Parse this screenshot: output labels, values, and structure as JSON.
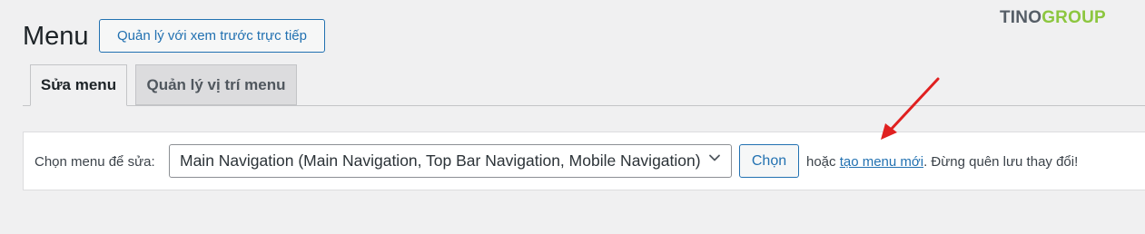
{
  "header": {
    "title": "Menu",
    "preview_button": "Quản lý với xem trước trực tiếp"
  },
  "logo": {
    "part1": "TINO",
    "part2": "GROUP"
  },
  "tabs": [
    {
      "label": "Sửa menu",
      "active": true
    },
    {
      "label": "Quản lý vị trí menu",
      "active": false
    }
  ],
  "manage": {
    "select_label": "Chọn menu để sửa:",
    "selected_menu": "Main Navigation (Main Navigation, Top Bar Navigation, Mobile Navigation)",
    "choose_button": "Chọn",
    "or_text": "hoặc",
    "create_link": "tạo menu mới",
    "reminder": ". Đừng quên lưu thay đổi!"
  },
  "colors": {
    "accent": "#2271b1",
    "annotation_arrow": "#e02020",
    "logo_green": "#8cc63f"
  }
}
